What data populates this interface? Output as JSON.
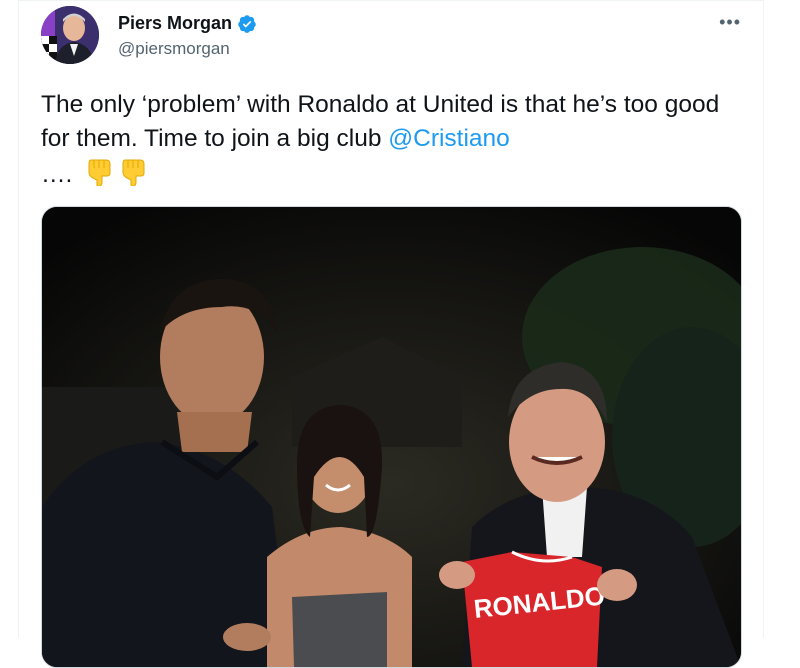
{
  "author": {
    "display_name": "Piers Morgan",
    "handle": "@piersmorgan",
    "verified": true,
    "avatar_icon": "profile-avatar"
  },
  "menu": {
    "more_label": "•••"
  },
  "tweet": {
    "text_main": "The only ‘problem’ with Ronaldo at United is that he’s too good for them. Time to join a big club ",
    "mention": "@Cristiano",
    "text_tail": "….",
    "emojis": [
      "pointing-down-hand",
      "pointing-down-hand"
    ]
  },
  "media": {
    "shirt_text": "RONALDO",
    "colors": {
      "shirt_red": "#d8262b",
      "verified_blue": "#1d9bf0",
      "mention_blue": "#1d9bf0"
    }
  }
}
